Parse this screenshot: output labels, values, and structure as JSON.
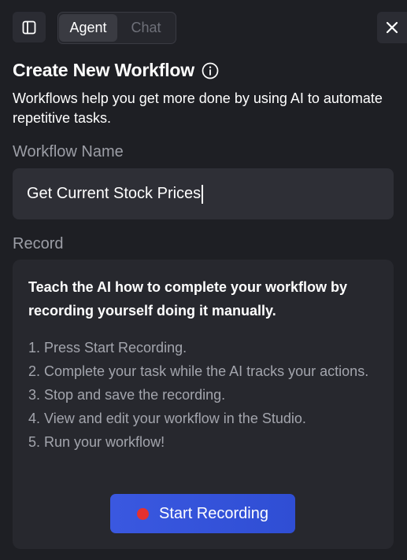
{
  "header": {
    "sidebar_toggle_icon": "sidebar-panel-icon",
    "tabs": [
      {
        "label": "Agent",
        "active": true
      },
      {
        "label": "Chat",
        "active": false
      }
    ],
    "close_icon": "close-icon"
  },
  "main": {
    "title": "Create New Workflow",
    "info_icon": "info-circle-icon",
    "description": "Workflows help you get more done by using AI to automate repetitive tasks.",
    "workflow_name_label": "Workflow Name",
    "workflow_name_value": "Get Current Stock Prices",
    "record_label": "Record",
    "record": {
      "intro": "Teach the AI how to complete your workflow by recording yourself doing it manually.",
      "steps": [
        "1. Press Start Recording.",
        "2. Complete your task while the AI tracks your actions.",
        "3. Stop and save the recording.",
        "4. View and edit your workflow in the Studio.",
        "5. Run your workflow!"
      ],
      "button_label": "Start Recording",
      "button_icon": "record-dot-icon"
    }
  },
  "colors": {
    "background": "#1e1f24",
    "card": "#27282e",
    "input": "#2e2f36",
    "accent": "#3a58e0",
    "record_dot": "#e5312f",
    "muted_text": "#a3a5ad"
  }
}
